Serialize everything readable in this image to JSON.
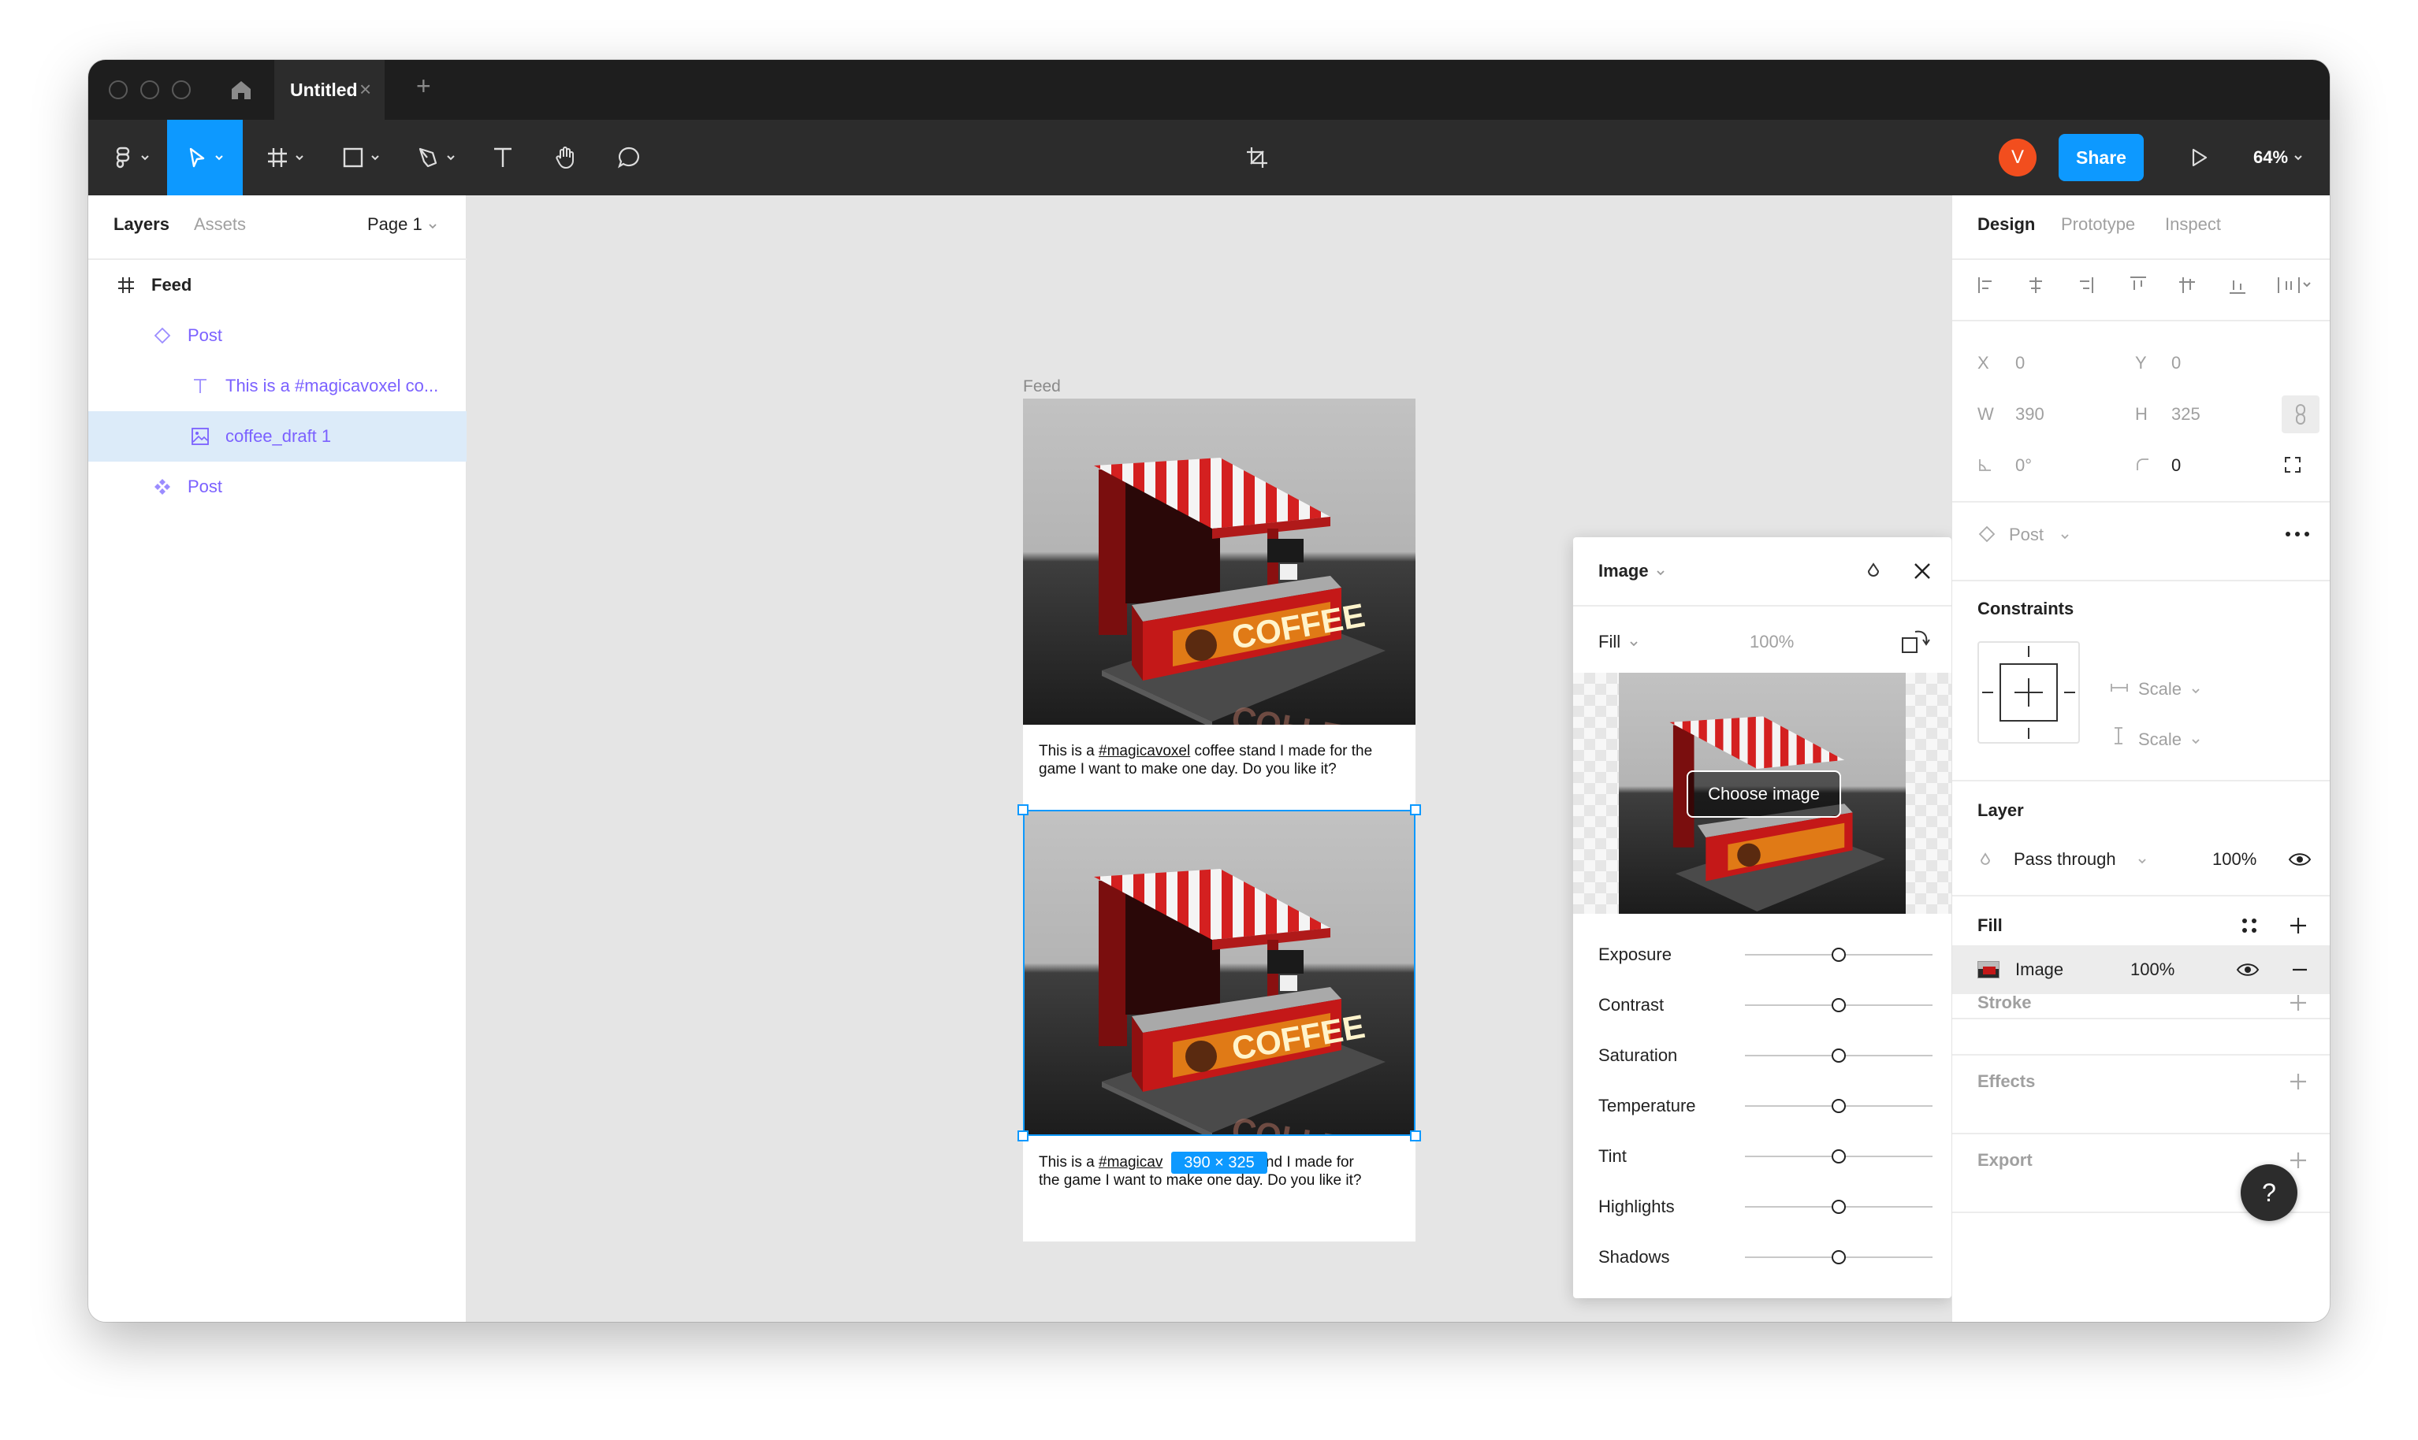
{
  "tab": {
    "title": "Untitled",
    "close": "×",
    "add": "+"
  },
  "toolbar": {
    "share_label": "Share",
    "avatar_initial": "V",
    "avatar_color": "#f24e1e",
    "zoom": "64%",
    "accent": "#0d99ff"
  },
  "left_panel": {
    "tabs": [
      "Layers",
      "Assets"
    ],
    "page_selector": "Page 1",
    "layers": [
      {
        "label": "Feed",
        "icon": "frame-icon"
      },
      {
        "label": "Post",
        "icon": "component-instance-icon"
      },
      {
        "label": "This is a #magicavoxel co...",
        "icon": "text-layer-icon"
      },
      {
        "label": "coffee_draft 1",
        "icon": "image-layer-icon",
        "selected": true
      },
      {
        "label": "Post",
        "icon": "component-icon"
      }
    ]
  },
  "canvas": {
    "frame_label": "Feed",
    "post_caption_prefix": "This is a ",
    "post_caption_tag": "#magicavoxel",
    "post_caption_rest": " coffee stand I made for the game I want to make one day. Do you like it?",
    "second_caption_tag": "#magicav",
    "second_caption_rest_line1": "and I made for",
    "second_caption_line2": "the game I want to make one day. Do you like it?",
    "size_badge": "390 × 325",
    "sign_text": "COFFEE"
  },
  "image_panel": {
    "title": "Image",
    "fill_mode": "Fill",
    "opacity": "100%",
    "choose_image": "Choose image",
    "adjustments": [
      {
        "label": "Exposure",
        "value": 0.5
      },
      {
        "label": "Contrast",
        "value": 0.5
      },
      {
        "label": "Saturation",
        "value": 0.5
      },
      {
        "label": "Temperature",
        "value": 0.5
      },
      {
        "label": "Tint",
        "value": 0.5
      },
      {
        "label": "Highlights",
        "value": 0.5
      },
      {
        "label": "Shadows",
        "value": 0.5
      }
    ]
  },
  "right_panel": {
    "tabs": [
      "Design",
      "Prototype",
      "Inspect"
    ],
    "x_label": "X",
    "x_value": "0",
    "y_label": "Y",
    "y_value": "0",
    "w_label": "W",
    "w_value": "390",
    "h_label": "H",
    "h_value": "325",
    "rotation_value": "0°",
    "radius_value": "0",
    "component_name": "Post",
    "constraints_title": "Constraints",
    "constraint_h": "Scale",
    "constraint_v": "Scale",
    "layer_title": "Layer",
    "blend_mode": "Pass through",
    "layer_opacity": "100%",
    "fill_title": "Fill",
    "fill_type": "Image",
    "fill_opacity": "100%",
    "stroke_title": "Stroke",
    "effects_title": "Effects",
    "export_title": "Export",
    "help": "?"
  }
}
